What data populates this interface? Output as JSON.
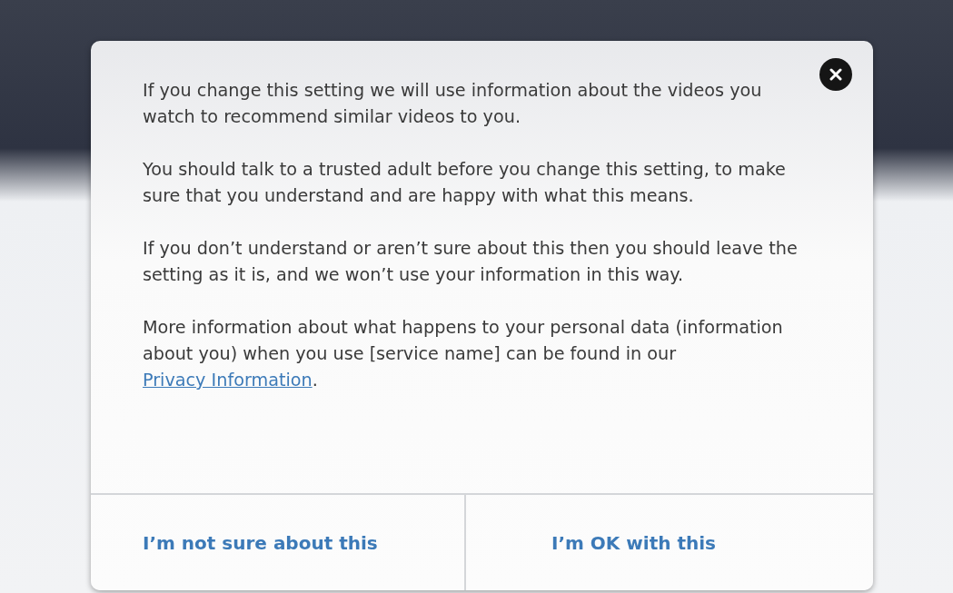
{
  "dialog": {
    "paragraphs": [
      "If you change this setting we will use information about the videos you watch to recommend similar videos to you.",
      "You should talk to a trusted adult before you change this setting, to make sure that you understand and are happy with what this means.",
      "If you don’t understand or aren’t sure about this then you should leave the setting as it is, and we won’t use your information in this way."
    ],
    "privacy_note": {
      "before": "More information about what happens to your personal data (information about you) when you use [service name] can be found in our ",
      "link": "Privacy Information",
      "after": "."
    },
    "buttons": [
      "I’m not sure about this",
      "I’m OK with this"
    ]
  }
}
